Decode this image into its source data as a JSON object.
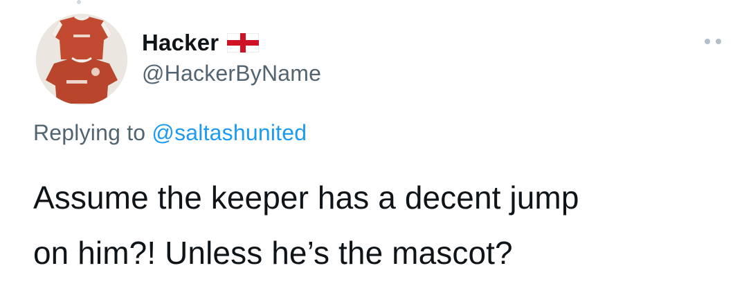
{
  "tweet": {
    "author": {
      "display_name": "Hacker",
      "flag_icon": "england-flag-icon",
      "handle": "@HackerByName"
    },
    "reply_context": {
      "prefix": "Replying to",
      "mention": "@saltashunited"
    },
    "text_lines": [
      "Assume the keeper has a decent jump",
      "on him?! Unless he’s the mascot?"
    ],
    "more_menu_icon": "more-options-icon"
  },
  "colors": {
    "text_primary": "#0f1419",
    "text_secondary": "#536471",
    "link": "#1d9bf0",
    "flag_red": "#ce1124",
    "jersey_red": "#b8452c"
  }
}
